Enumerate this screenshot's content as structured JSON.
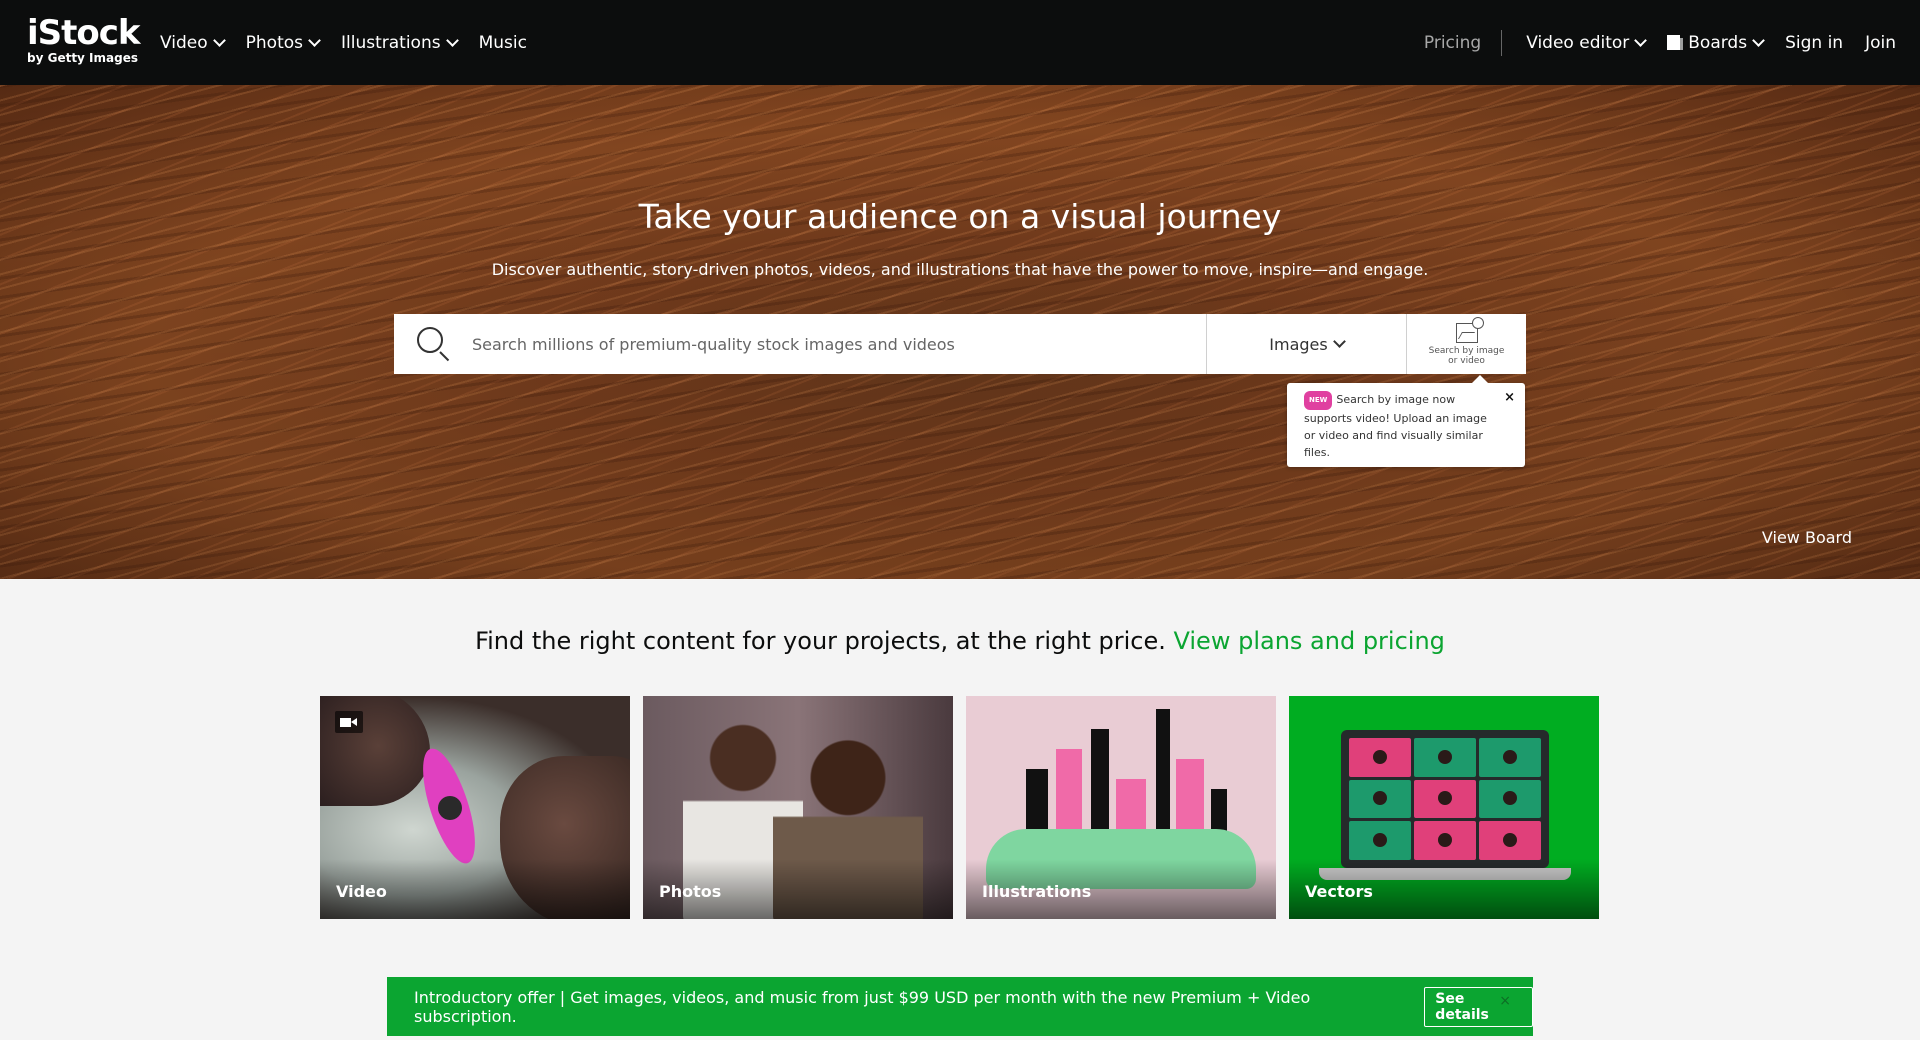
{
  "header": {
    "logo_brand": "iStock",
    "logo_sub": "by Getty Images",
    "nav_left": [
      "Video",
      "Photos",
      "Illustrations",
      "Music"
    ],
    "pricing": "Pricing",
    "video_editor": "Video editor",
    "boards": "Boards",
    "sign_in": "Sign in",
    "join": "Join"
  },
  "hero": {
    "title": "Take your audience on a visual journey",
    "subtitle": "Discover authentic, story-driven photos, videos, and illustrations that have the power to move, inspire—and engage.",
    "search_placeholder": "Search millions of premium-quality stock images and videos",
    "search_type": "Images",
    "search_by_image_line1": "Search by image",
    "search_by_image_line2": "or video",
    "tooltip_badge": "NEW",
    "tooltip_text": "Search by image now supports video! Upload an image or video and find visually similar files.",
    "tooltip_close": "×",
    "view_board": "View Board"
  },
  "content": {
    "promo_text": "Find the right content for your projects, at the right price.",
    "promo_link": "View plans and pricing",
    "cards": [
      "Video",
      "Photos",
      "Illustrations",
      "Vectors"
    ]
  },
  "offer": {
    "text": "Introductory offer | Get images, videos, and music from just $99 USD per month with the new Premium + Video subscription.",
    "button": "See details",
    "close": "×"
  },
  "colors": {
    "header_bg": "#0c0d0d",
    "brand_green": "#0ba531",
    "new_badge": "#e040a0"
  }
}
